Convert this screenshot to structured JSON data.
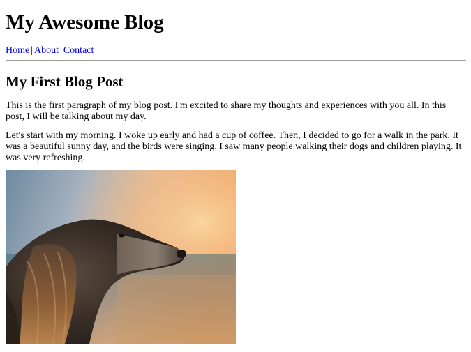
{
  "header": {
    "site_title": "My Awesome Blog"
  },
  "nav": {
    "items": [
      {
        "label": "Home"
      },
      {
        "label": "About"
      },
      {
        "label": "Contact"
      }
    ],
    "separator": "|"
  },
  "post": {
    "title": "My First Blog Post",
    "paragraphs": [
      "This is the first paragraph of my blog post. I'm excited to share my thoughts and experiences with you all. In this post, I will be talking about my day.",
      "Let's start with my morning. I woke up early and had a cup of coffee. Then, I decided to go for a walk in the park. It was a beautiful sunny day, and the birds were singing. I saw many people walking their dogs and children playing. It was very refreshing."
    ]
  },
  "colors": {
    "link": "#0000ee",
    "text": "#000000",
    "divider": "#9a9a9a"
  }
}
